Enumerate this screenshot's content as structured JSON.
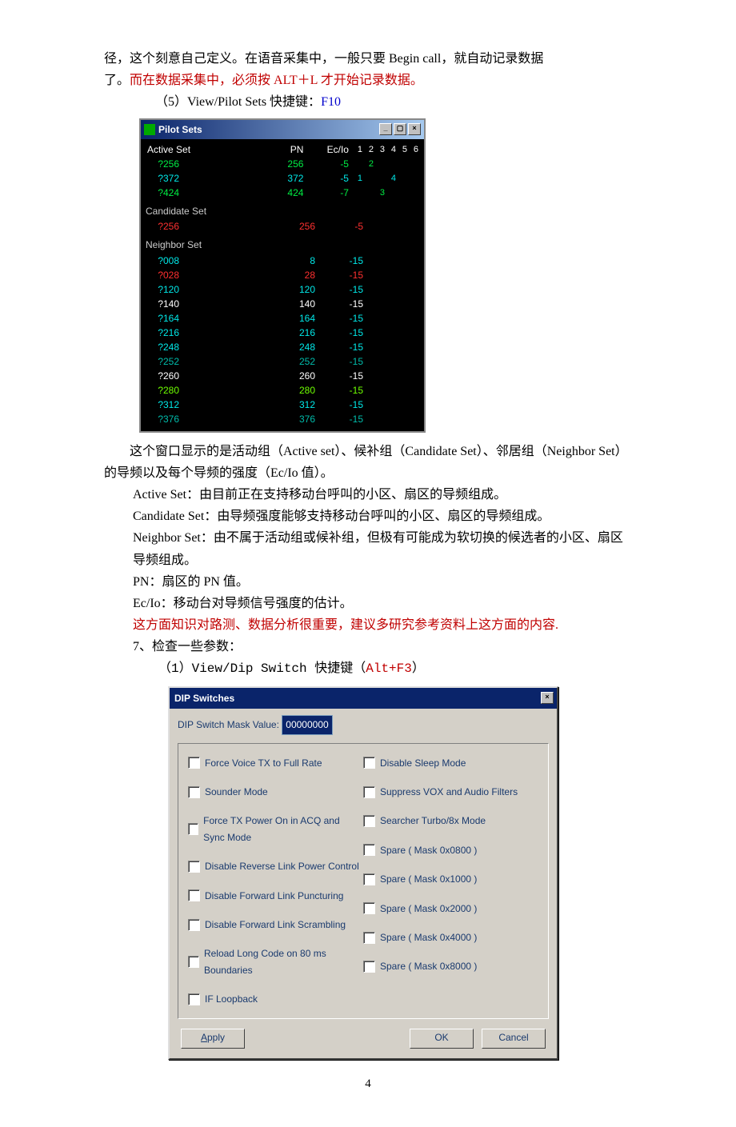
{
  "intro": {
    "line1": "径，这个刻意自己定义。在语音采集中，一般只要 Begin call，就自动记录数据",
    "line2a": "了。",
    "line2b": "而在数据采集中，必须按 ALT＋L 才开始记录数据。",
    "line3a": "（5）View/Pilot Sets 快捷键：",
    "line3b": "F10"
  },
  "pilot": {
    "title": "Pilot Sets",
    "header": {
      "name": "Active Set",
      "pn": "PN",
      "ecio": "Ec/Io",
      "nums": [
        "1",
        "2",
        "3",
        "4",
        "5",
        "6"
      ]
    },
    "active": [
      {
        "name": "?256",
        "pn": "256",
        "ecio": "-5",
        "pos": 2,
        "cls": "g-green"
      },
      {
        "name": "?372",
        "pn": "372",
        "ecio": "-5",
        "pos1": 1,
        "pos2": 4,
        "cls": "g-cyan"
      },
      {
        "name": "?424",
        "pn": "424",
        "ecio": "-7",
        "pos": 3,
        "cls": "g-green"
      }
    ],
    "candidate_label": "Candidate Set",
    "candidate": [
      {
        "name": "?256",
        "pn": "256",
        "ecio": "-5",
        "cls": "g-red"
      }
    ],
    "neighbor_label": "Neighbor Set",
    "neighbor": [
      {
        "name": "?008",
        "pn": "8",
        "ecio": "-15",
        "cls": "g-cyan"
      },
      {
        "name": "?028",
        "pn": "28",
        "ecio": "-15",
        "cls": "g-red"
      },
      {
        "name": "?120",
        "pn": "120",
        "ecio": "-15",
        "cls": "g-cyan"
      },
      {
        "name": "?140",
        "pn": "140",
        "ecio": "-15",
        "cls": "g-white"
      },
      {
        "name": "?164",
        "pn": "164",
        "ecio": "-15",
        "cls": "g-cyan"
      },
      {
        "name": "?216",
        "pn": "216",
        "ecio": "-15",
        "cls": "g-cyan"
      },
      {
        "name": "?248",
        "pn": "248",
        "ecio": "-15",
        "cls": "g-cyan"
      },
      {
        "name": "?252",
        "pn": "252",
        "ecio": "-15",
        "cls": "g-teal"
      },
      {
        "name": "?260",
        "pn": "260",
        "ecio": "-15",
        "cls": "g-white"
      },
      {
        "name": "?280",
        "pn": "280",
        "ecio": "-15",
        "cls": "g-lime"
      },
      {
        "name": "?312",
        "pn": "312",
        "ecio": "-15",
        "cls": "g-cyan"
      },
      {
        "name": "?376",
        "pn": "376",
        "ecio": "-15",
        "cls": "g-teal"
      }
    ]
  },
  "explain": {
    "p1": "这个窗口显示的是活动组（Active set）、候补组（Candidate Set）、邻居组（Neighbor Set）的导频以及每个导频的强度（Ec/Io 值）。",
    "p2": "Active Set：由目前正在支持移动台呼叫的小区、扇区的导频组成。",
    "p3": "Candidate Set：由导频强度能够支持移动台呼叫的小区、扇区的导频组成。",
    "p4": "Neighbor Set：由不属于活动组或候补组，但极有可能成为软切换的候选者的小区、扇区导频组成。",
    "p5": "PN：扇区的 PN 值。",
    "p6": "Ec/Io：移动台对导频信号强度的估计。",
    "p7": "这方面知识对路测、数据分析很重要，建议多研究参考资料上这方面的内容.",
    "p8": "7、检查一些参数：",
    "p9a": "（1）View/Dip Switch 快捷键（",
    "p9b": "Alt+F3",
    "p9c": "）"
  },
  "dip": {
    "title": "DIP Switches",
    "mask_label": "DIP Switch Mask Value:",
    "mask_value": "00000000",
    "left": [
      "Force Voice TX to Full Rate",
      "Sounder Mode",
      "Force TX Power On in ACQ and Sync Mode",
      "Disable Reverse Link Power Control",
      "Disable Forward Link Puncturing",
      "Disable Forward Link Scrambling",
      "Reload Long Code on 80 ms Boundaries",
      "IF Loopback"
    ],
    "right": [
      "Disable Sleep Mode",
      "Suppress VOX and Audio Filters",
      "Searcher Turbo/8x Mode",
      "Spare ( Mask 0x0800 )",
      "Spare ( Mask 0x1000 )",
      "Spare ( Mask 0x2000 )",
      "Spare ( Mask 0x4000 )",
      "Spare ( Mask 0x8000 )"
    ],
    "apply": "Apply",
    "ok": "OK",
    "cancel": "Cancel"
  },
  "pagenum": "4"
}
